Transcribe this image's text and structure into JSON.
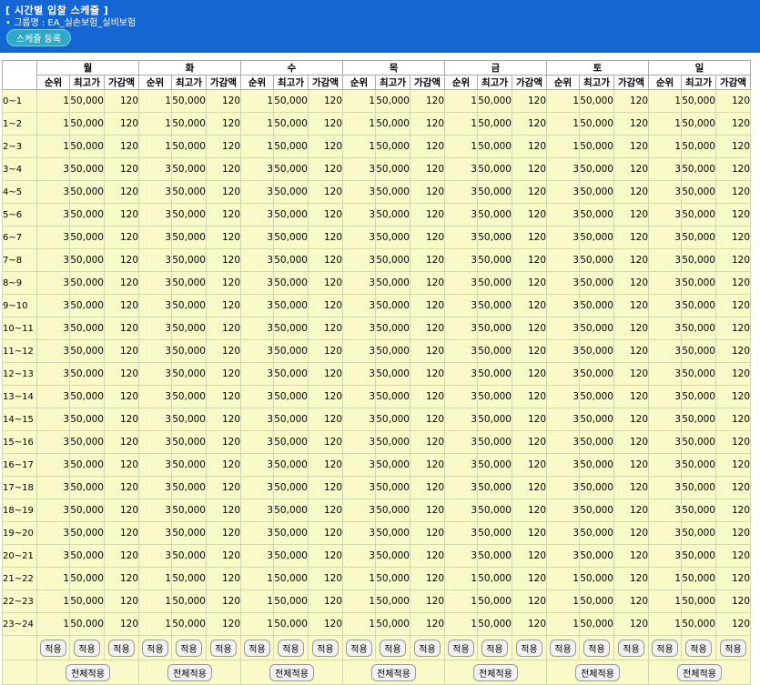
{
  "header": {
    "title": "[ 시간별 입찰 스케쥴 ]",
    "group_label": "• 그룹명 : EA_실손보험_실비보험",
    "register_button": "스케쥴 등록"
  },
  "columns": {
    "days": [
      "월",
      "화",
      "수",
      "목",
      "금",
      "토",
      "일"
    ],
    "sub": [
      "순위",
      "최고가",
      "가감액"
    ]
  },
  "rows": [
    {
      "hour": "0~1",
      "rank": "1",
      "max_price": "50,000",
      "adjust": "120"
    },
    {
      "hour": "1~2",
      "rank": "1",
      "max_price": "50,000",
      "adjust": "120"
    },
    {
      "hour": "2~3",
      "rank": "1",
      "max_price": "50,000",
      "adjust": "120"
    },
    {
      "hour": "3~4",
      "rank": "3",
      "max_price": "50,000",
      "adjust": "120"
    },
    {
      "hour": "4~5",
      "rank": "3",
      "max_price": "50,000",
      "adjust": "120"
    },
    {
      "hour": "5~6",
      "rank": "3",
      "max_price": "50,000",
      "adjust": "120"
    },
    {
      "hour": "6~7",
      "rank": "3",
      "max_price": "50,000",
      "adjust": "120"
    },
    {
      "hour": "7~8",
      "rank": "3",
      "max_price": "50,000",
      "adjust": "120"
    },
    {
      "hour": "8~9",
      "rank": "3",
      "max_price": "50,000",
      "adjust": "120"
    },
    {
      "hour": "9~10",
      "rank": "3",
      "max_price": "50,000",
      "adjust": "120"
    },
    {
      "hour": "10~11",
      "rank": "3",
      "max_price": "50,000",
      "adjust": "120"
    },
    {
      "hour": "11~12",
      "rank": "3",
      "max_price": "50,000",
      "adjust": "120"
    },
    {
      "hour": "12~13",
      "rank": "3",
      "max_price": "50,000",
      "adjust": "120"
    },
    {
      "hour": "13~14",
      "rank": "3",
      "max_price": "50,000",
      "adjust": "120"
    },
    {
      "hour": "14~15",
      "rank": "3",
      "max_price": "50,000",
      "adjust": "120"
    },
    {
      "hour": "15~16",
      "rank": "3",
      "max_price": "50,000",
      "adjust": "120"
    },
    {
      "hour": "16~17",
      "rank": "3",
      "max_price": "50,000",
      "adjust": "120"
    },
    {
      "hour": "17~18",
      "rank": "3",
      "max_price": "50,000",
      "adjust": "120"
    },
    {
      "hour": "18~19",
      "rank": "3",
      "max_price": "50,000",
      "adjust": "120"
    },
    {
      "hour": "19~20",
      "rank": "3",
      "max_price": "50,000",
      "adjust": "120"
    },
    {
      "hour": "20~21",
      "rank": "3",
      "max_price": "50,000",
      "adjust": "120"
    },
    {
      "hour": "21~22",
      "rank": "1",
      "max_price": "50,000",
      "adjust": "120"
    },
    {
      "hour": "22~23",
      "rank": "1",
      "max_price": "50,000",
      "adjust": "120"
    },
    {
      "hour": "23~24",
      "rank": "1",
      "max_price": "50,000",
      "adjust": "120"
    }
  ],
  "apply_label": "적용",
  "full_apply_label": "전체적용",
  "colors": {
    "header_bg": "#1466d4",
    "register_button_bg": "#2fa9c7",
    "grid_bg": "#fafac9"
  }
}
